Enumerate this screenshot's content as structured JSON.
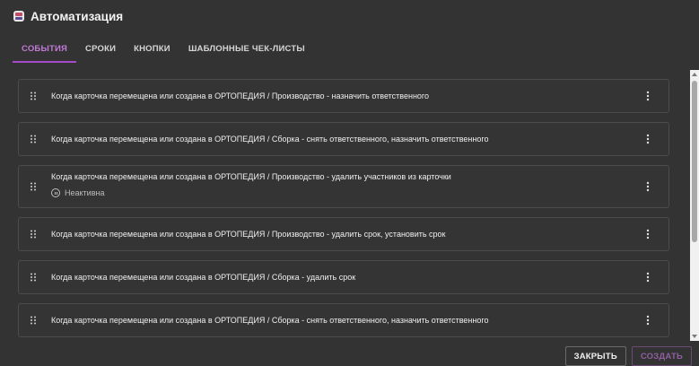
{
  "header": {
    "title": "Автоматизация",
    "icon": "automation-icon"
  },
  "tabs": [
    {
      "label": "СОБЫТИЯ",
      "active": true
    },
    {
      "label": "СРОКИ",
      "active": false
    },
    {
      "label": "КНОПКИ",
      "active": false
    },
    {
      "label": "ШАБЛОННЫЕ ЧЕК-ЛИСТЫ",
      "active": false
    }
  ],
  "rules": [
    {
      "text": "Когда карточка перемещена или создана в ОРТОПЕДИЯ / Производство - назначить ответственного"
    },
    {
      "text": "Когда карточка перемещена или создана в ОРТОПЕДИЯ / Сборка - снять ответственного, назначить ответственного"
    },
    {
      "text": "Когда карточка перемещена или создана в ОРТОПЕДИЯ / Производство - удалить участников из карточки",
      "status": "Неактивна"
    },
    {
      "text": "Когда карточка перемещена или создана в ОРТОПЕДИЯ / Производство - удалить срок, установить срок"
    },
    {
      "text": "Когда карточка перемещена или создана в ОРТОПЕДИЯ / Сборка - удалить срок"
    },
    {
      "text": "Когда карточка перемещена или создана в ОРТОПЕДИЯ / Сборка - снять ответственного, назначить ответственного"
    }
  ],
  "footer": {
    "close_label": "ЗАКРЫТЬ",
    "create_label": "СОЗДАТЬ"
  },
  "colors": {
    "accent": "#a64bc7",
    "background": "#333333",
    "card_border": "#4c4c4c"
  }
}
